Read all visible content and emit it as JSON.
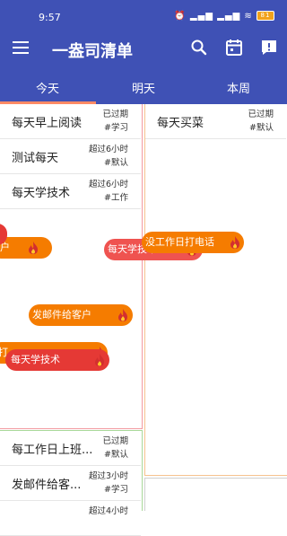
{
  "status_bar": {
    "time": "9:57",
    "signal_text": "⏰ ▂▄▆ ▂▄▆ ≋",
    "battery": "81"
  },
  "toolbar": {
    "title": "一盎司清单",
    "icons": [
      "menu-icon",
      "search-icon",
      "calendar-icon",
      "feedback-icon"
    ]
  },
  "tabs": [
    {
      "label": "今天"
    },
    {
      "label": "明天"
    },
    {
      "label": "本周"
    }
  ],
  "colors": {
    "primary": "#3f51b5",
    "tab_indicator": "#ff8a65",
    "pill_orange": "#f57c00",
    "pill_red": "#e53935",
    "flame": "#d32f2f"
  },
  "quadrant_top_left": {
    "items": [
      {
        "name": "每天早上阅读",
        "status": "已过期",
        "tag": "#学习"
      },
      {
        "name": "测试每天",
        "status": "超过6小时",
        "tag": "#默认"
      },
      {
        "name": "每天学技术",
        "status": "超过6小时",
        "tag": "#工作"
      }
    ]
  },
  "quadrant_top_right": {
    "items": [
      {
        "name": "每天买菜",
        "status": "已过期",
        "tag": "#默认"
      }
    ]
  },
  "quadrant_bottom_left": {
    "items": [
      {
        "name": "每工作日上班...",
        "status": "已过期",
        "tag": "#默认"
      },
      {
        "name": "发邮件给客...",
        "status": "超过3小时",
        "tag": "#学习"
      },
      {
        "name": "",
        "status": "超过4小时",
        "tag": ""
      }
    ]
  },
  "floating_pills": [
    {
      "label": "户"
    },
    {
      "label": ""
    },
    {
      "label": "每天学技术"
    },
    {
      "label": "没工作日打电话"
    },
    {
      "label": "发邮件给客户"
    },
    {
      "label": "打"
    },
    {
      "label": "每天学技术"
    }
  ]
}
